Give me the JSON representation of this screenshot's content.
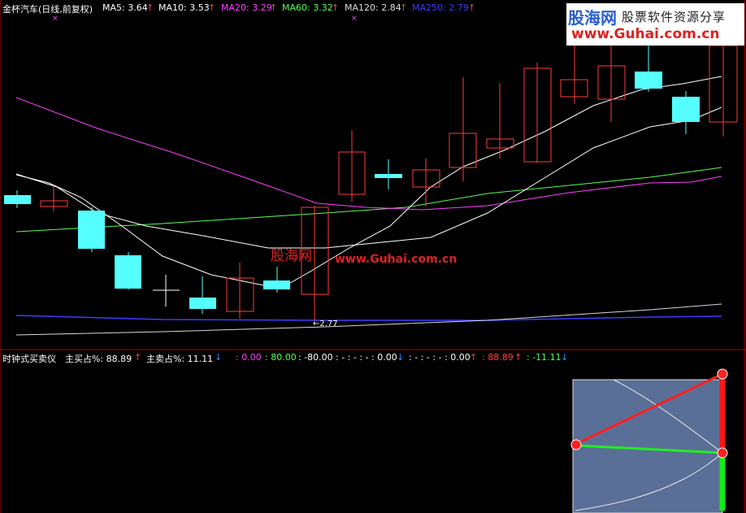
{
  "legend": {
    "title": "金杯汽车(日线,前复权)",
    "ma5": "MA5: 3.64",
    "ma10": "MA10: 3.53",
    "ma20": "MA20: 3.29",
    "ma60": "MA60: 3.32",
    "ma120": "MA120: 2.84",
    "ma250": "MA250: 2.79",
    "up": "↑"
  },
  "sub": {
    "title": "时钟式买卖仪",
    "buy": "主买占%: 88.89",
    "sell": "主卖占%: 11.11",
    "v1": ": 0.00",
    "v2": ": 80.00",
    "v3": ": -80.00",
    "v4": ": - : - : - : 0.00",
    "v5": ": - : - : - : 0.00",
    "v6": ": 88.89",
    "v7": ": -11.11",
    "up": "↑",
    "dn": "↓"
  },
  "price_label": "←2.77",
  "watermark": {
    "logo_cn": "股海网",
    "slogan": "股票软件资源分享",
    "url": "www.Guhai.com.cn",
    "mid_cn": "股海网",
    "mid_url": "www.Guhai.com.cn"
  },
  "colors": {
    "up": "#ff3b3b",
    "down": "#55ffff",
    "ma5": "#ffffff",
    "ma20": "#ff40ff",
    "ma60": "#55ff55",
    "ma120": "#cccccc",
    "ma250": "#3d3dff"
  }
}
